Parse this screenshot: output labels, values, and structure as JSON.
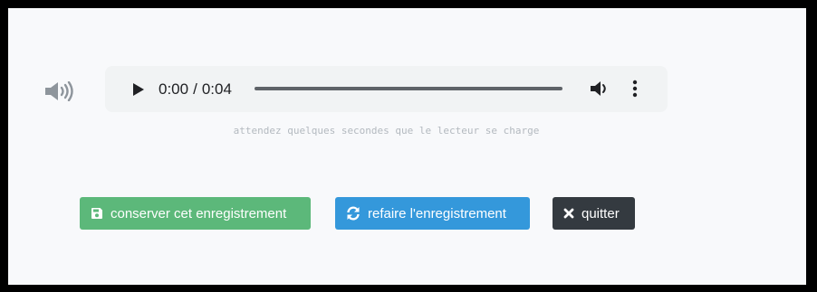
{
  "colors": {
    "save": "#5cb87a",
    "redo": "#3498db",
    "quit": "#343a40",
    "speaker": "#8e959c"
  },
  "audio_player": {
    "current_time": "0:00",
    "separator": "/",
    "duration": "0:04",
    "progress": 0,
    "icons": {
      "play": "play-icon",
      "volume": "volume-icon",
      "more": "more-options-icon"
    }
  },
  "hint": "attendez quelques secondes que le lecteur se charge",
  "buttons": {
    "save": {
      "label": "conserver cet enregistrement",
      "icon": "save-icon"
    },
    "redo": {
      "label": "refaire l'enregistrement",
      "icon": "refresh-icon"
    },
    "quit": {
      "label": "quitter",
      "icon": "close-icon"
    }
  },
  "speaker_icon": "speaker-icon"
}
